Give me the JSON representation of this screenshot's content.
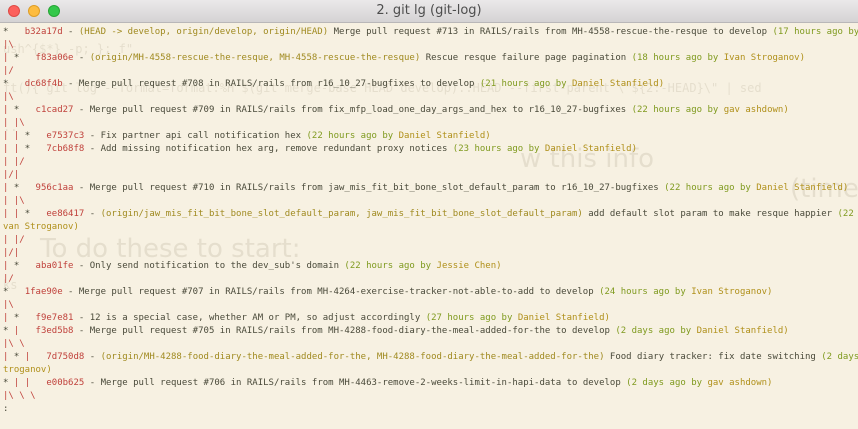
{
  "window": {
    "title": "2. git lg (git-log)"
  },
  "terminal": {
    "ghost_text": [
      "ush^{$*} -p; }; f\"",
      "ft(){ git log --format=format:%H $(git merge-base HEAD develop)..HEAD --first-parent \\\"${2:-HEAD}\\\" | sed",
      "..",
      "w this info",
      "(time)",
      "To do these to start:",
      "ks"
    ],
    "lines": [
      {
        "graph": "*",
        "hash": "b32a17d",
        "refs": "(HEAD -> develop, origin/develop, origin/HEAD)",
        "message": "Merge pull request #713 in RAILS/rails from MH-4558-rescue-the-resque to develop",
        "date": "(17 hours ago by",
        "author": "gav ashdown"
      },
      {
        "graph": "|\\",
        "hash": "",
        "refs": "",
        "message": "",
        "date": "",
        "author": ""
      },
      {
        "graph": "| * ",
        "hash": "f83a06e",
        "refs": "(origin/MH-4558-rescue-the-resque, MH-4558-rescue-the-resque)",
        "message": "Rescue resque failure page pagination",
        "date": "(18 hours ago by",
        "author": "Ivan Stroganov)"
      },
      {
        "graph": "|/",
        "hash": "",
        "refs": "",
        "message": "",
        "date": "",
        "author": ""
      },
      {
        "graph": "*",
        "hash": "dc68f4b",
        "refs": "",
        "message": "Merge pull request #708 in RAILS/rails from r16_10_27-bugfixes to develop",
        "date": "(21 hours ago by",
        "author": "Daniel Stanfield)"
      },
      {
        "graph": "|\\",
        "hash": "",
        "refs": "",
        "message": "",
        "date": "",
        "author": ""
      },
      {
        "graph": "| *",
        "hash": "c1cad27",
        "refs": "",
        "message": "Merge pull request #709 in RAILS/rails from fix_mfp_load_one_day_args_and_hex to r16_10_27-bugfixes",
        "date": "(22 hours ago by",
        "author": "gav ashdown)"
      },
      {
        "graph": "| |\\",
        "hash": "",
        "refs": "",
        "message": "",
        "date": "",
        "author": ""
      },
      {
        "graph": "| | * ",
        "hash": "e7537c3",
        "refs": "",
        "message": "Fix partner api call notification hex",
        "date": "(22 hours ago by",
        "author": "Daniel Stanfield)"
      },
      {
        "graph": "| | * ",
        "hash": "7cb68f8",
        "refs": "",
        "message": "Add missing notification hex arg, remove redundant proxy notices",
        "date": "(23 hours ago by",
        "author": "Daniel Stanfield)"
      },
      {
        "graph": "| |/",
        "hash": "",
        "refs": "",
        "message": "",
        "date": "",
        "author": ""
      },
      {
        "graph": "|/|",
        "hash": "",
        "refs": "",
        "message": "",
        "date": "",
        "author": ""
      },
      {
        "graph": "| *",
        "hash": "956c1aa",
        "refs": "",
        "message": "Merge pull request #710 in RAILS/rails from jaw_mis_fit_bit_bone_slot_default_param to r16_10_27-bugfixes",
        "date": "(22 hours ago by",
        "author": "Daniel Stanfield)"
      },
      {
        "graph": "| |\\",
        "hash": "",
        "refs": "",
        "message": "",
        "date": "",
        "author": ""
      },
      {
        "graph": "| | * ",
        "hash": "ee86417",
        "refs": "(origin/jaw_mis_fit_bit_bone_slot_default_param, jaw_mis_fit_bit_bone_slot_default_param)",
        "message": "add default slot param to make resque happier",
        "date": "(22 hours ago by I",
        "author": ""
      },
      {
        "graph": "",
        "hash": "",
        "refs": "",
        "message": "",
        "date": "",
        "author": "van Stroganov)"
      },
      {
        "graph": "| |/",
        "hash": "",
        "refs": "",
        "message": "",
        "date": "",
        "author": ""
      },
      {
        "graph": "|/|",
        "hash": "",
        "refs": "",
        "message": "",
        "date": "",
        "author": ""
      },
      {
        "graph": "| * ",
        "hash": "aba01fe",
        "refs": "",
        "message": "Only send notification to the dev_sub's domain",
        "date": "(22 hours ago by",
        "author": "Jessie Chen)"
      },
      {
        "graph": "|/",
        "hash": "",
        "refs": "",
        "message": "",
        "date": "",
        "author": ""
      },
      {
        "graph": "*",
        "hash": "1fae90e",
        "refs": "",
        "message": "Merge pull request #707 in RAILS/rails from MH-4264-exercise-tracker-not-able-to-add to develop",
        "date": "(24 hours ago by",
        "author": "Ivan Stroganov)"
      },
      {
        "graph": "|\\",
        "hash": "",
        "refs": "",
        "message": "",
        "date": "",
        "author": ""
      },
      {
        "graph": "| * ",
        "hash": "f9e7e81",
        "refs": "",
        "message": "12 is a special case, whether AM or PM, so adjust accordingly",
        "date": "(27 hours ago by",
        "author": "Daniel Stanfield)"
      },
      {
        "graph": "* |",
        "hash": "f3ed5b8",
        "refs": "",
        "message": "Merge pull request #705 in RAILS/rails from MH-4288-food-diary-the-meal-added-for-the to develop",
        "date": "(2 days ago by",
        "author": "Daniel Stanfield)"
      },
      {
        "graph": "|\\ \\",
        "hash": "",
        "refs": "",
        "message": "",
        "date": "",
        "author": ""
      },
      {
        "graph": "| * |",
        "hash": "7d750d8",
        "refs": "(origin/MH-4288-food-diary-the-meal-added-for-the, MH-4288-food-diary-the-meal-added-for-the)",
        "message": "Food diary tracker: fix date switching",
        "date": "(2 days ago by Ivan S",
        "author": ""
      },
      {
        "graph": "",
        "hash": "",
        "refs": "",
        "message": "",
        "date": "",
        "author": "troganov)"
      },
      {
        "graph": "* | |",
        "hash": "e00b625",
        "refs": "",
        "message": "Merge pull request #706 in RAILS/rails from MH-4463-remove-2-weeks-limit-in-hapi-data to develop",
        "date": "(2 days ago by",
        "author": "gav ashdown)"
      },
      {
        "graph": "|\\ \\ \\",
        "hash": "",
        "refs": "",
        "message": "",
        "date": "",
        "author": ""
      },
      {
        "graph": ":",
        "hash": "",
        "refs": "",
        "message": "",
        "date": "",
        "author": ""
      }
    ]
  }
}
